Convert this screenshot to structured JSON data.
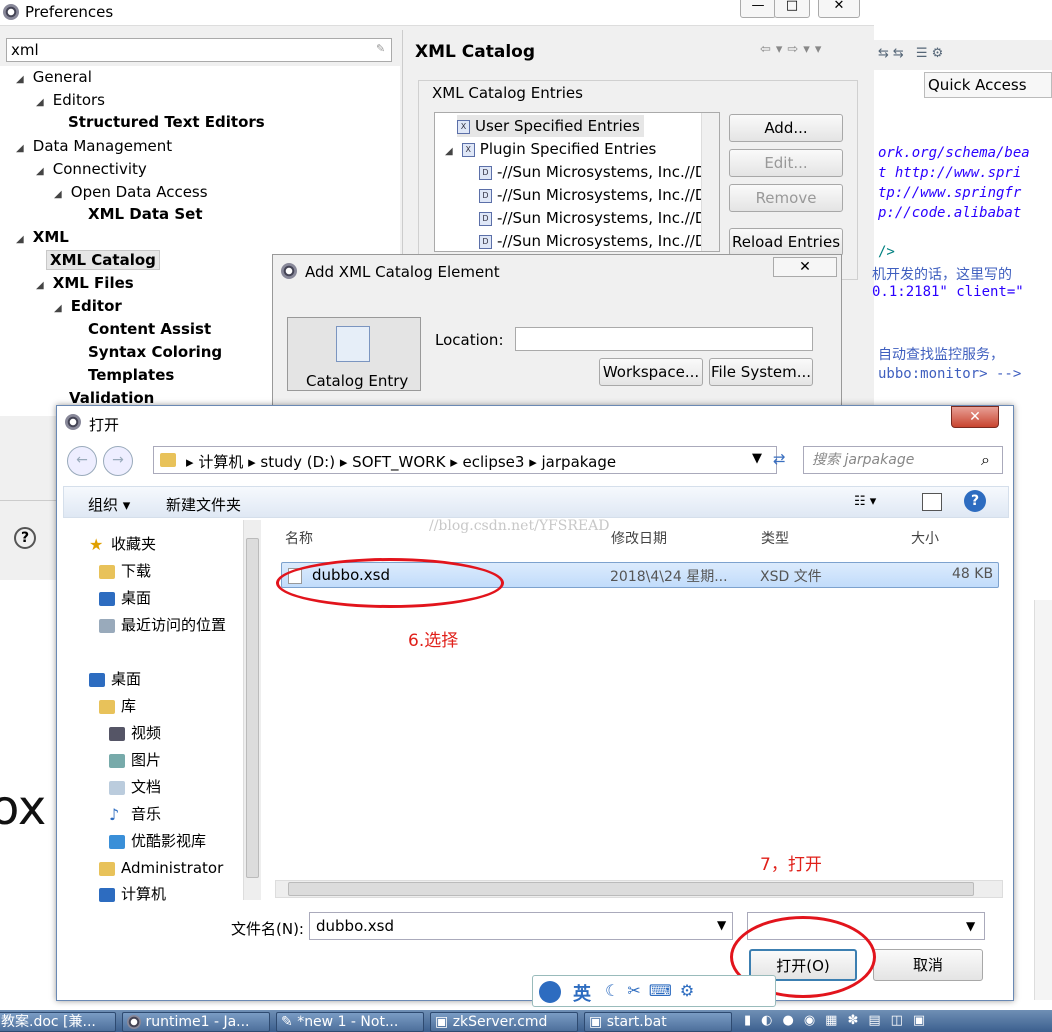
{
  "preferences": {
    "title": "Preferences",
    "filter": "xml",
    "tree": [
      {
        "label": "General",
        "bold": false
      },
      {
        "label": "Editors",
        "bold": false
      },
      {
        "label": "Structured Text Editors",
        "bold": true
      },
      {
        "label": "Data Management",
        "bold": false
      },
      {
        "label": "Connectivity",
        "bold": false
      },
      {
        "label": "Open Data Access",
        "bold": false
      },
      {
        "label": "XML Data Set",
        "bold": true
      },
      {
        "label": "XML",
        "bold": true
      },
      {
        "label": "XML Catalog",
        "bold": true
      },
      {
        "label": "XML Files",
        "bold": true
      },
      {
        "label": "Editor",
        "bold": true
      },
      {
        "label": "Content Assist",
        "bold": true
      },
      {
        "label": "Syntax Coloring",
        "bold": true
      },
      {
        "label": "Templates",
        "bold": true
      },
      {
        "label": "Validation",
        "bold": true
      }
    ],
    "page_title": "XML Catalog",
    "group_label": "XML Catalog Entries",
    "entries": [
      "User Specified Entries",
      "Plugin Specified Entries",
      "-//Sun Microsystems, Inc.//D",
      "-//Sun Microsystems, Inc.//D",
      "-//Sun Microsystems, Inc.//D",
      "-//Sun Microsystems, Inc.//D"
    ],
    "buttons": {
      "add": "Add...",
      "edit": "Edit...",
      "remove": "Remove",
      "reload": "Reload Entries"
    }
  },
  "editor": {
    "quick_access": "Quick Access",
    "lines": [
      "ork.org/schema/bea",
      "t http://www.spri",
      "tp://www.springfr",
      "p://code.alibabat",
      "/>",
      "机开发的话，这里写的",
      "0.1:2181\" client=\"",
      "自动查找监控服务，",
      "ubbo:monitor> -->"
    ]
  },
  "add_catalog": {
    "title": "Add XML Catalog Element",
    "side_item": "Catalog Entry",
    "location_label": "Location:",
    "workspace": "Workspace...",
    "file_system": "File System..."
  },
  "open_dialog": {
    "title": "打开",
    "breadcrumb": [
      "计算机",
      "study (D:)",
      "SOFT_WORK",
      "eclipse3",
      "jarpakage"
    ],
    "search_placeholder": "搜索 jarpakage",
    "organize": "组织",
    "new_folder": "新建文件夹",
    "nav": [
      "收藏夹",
      "下载",
      "桌面",
      "最近访问的位置",
      "桌面",
      "库",
      "视频",
      "图片",
      "文档",
      "音乐",
      "优酷影视库",
      "Administrator",
      "计算机"
    ],
    "columns": [
      "名称",
      "修改日期",
      "类型",
      "大小"
    ],
    "file": {
      "name": "dubbo.xsd",
      "date": "2018\\4\\24 星期...",
      "type": "XSD 文件",
      "size": "48 KB"
    },
    "filename_label": "文件名(N):",
    "filename_value": "dubbo.xsd",
    "open_btn": "打开(O)",
    "cancel_btn": "取消",
    "watermark": "//blog.csdn.net/YFSREAD"
  },
  "annotations": {
    "select": "6.选择",
    "open": "7，打开"
  },
  "ime": {
    "label": "英"
  },
  "taskbar": [
    "教案.doc [兼...",
    "runtime1 - Ja...",
    "*new 1 - Not...",
    "zkServer.cmd",
    "start.bat"
  ],
  "background_text": "ox"
}
